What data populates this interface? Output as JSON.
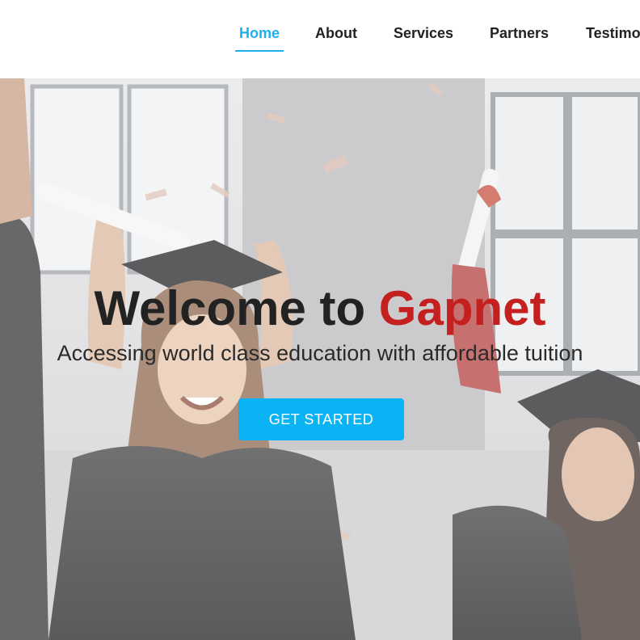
{
  "nav": {
    "items": [
      {
        "label": "Home",
        "active": true
      },
      {
        "label": "About",
        "active": false
      },
      {
        "label": "Services",
        "active": false
      },
      {
        "label": "Partners",
        "active": false
      },
      {
        "label": "Testimo",
        "active": false
      }
    ]
  },
  "hero": {
    "title_prefix": "Welcome to ",
    "title_brand": "Gapnet",
    "subtitle": "Accessing world class education with affordable tuition",
    "cta_label": "GET STARTED",
    "background_image": "graduates-celebrating-photo"
  },
  "colors": {
    "accent": "#1cb0f0",
    "brand_red": "#c42020",
    "cta_background": "#0ab4f4"
  }
}
